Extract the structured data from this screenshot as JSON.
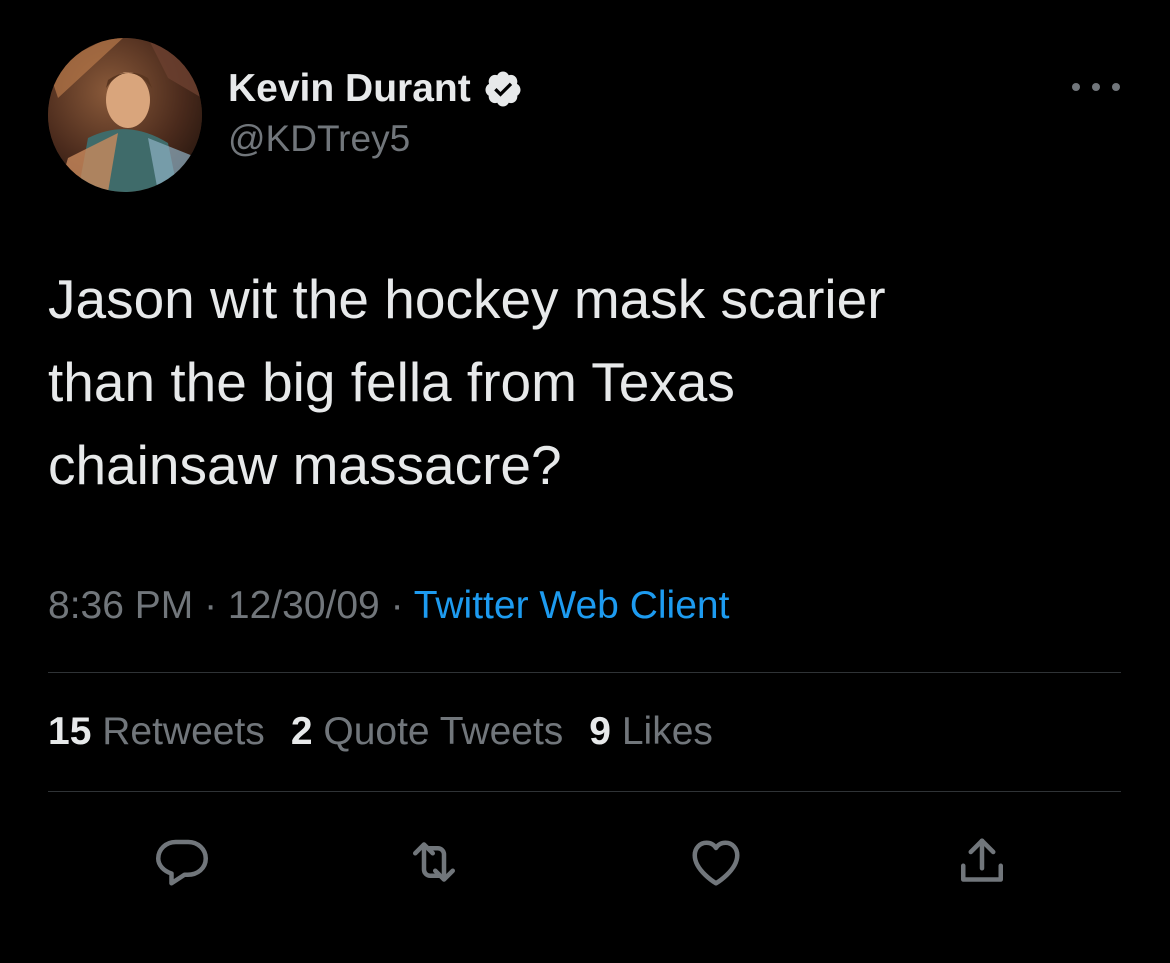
{
  "author": {
    "display_name": "Kevin Durant",
    "handle": "@KDTrey5",
    "verified_icon": "verified-badge-icon",
    "avatar_icon": "avatar"
  },
  "tweet": {
    "text_lines": [
      "Jason wit the hockey mask scarier",
      "than the big fella from Texas",
      "chainsaw massacre?"
    ]
  },
  "meta": {
    "time": "8:36 PM",
    "separator": " · ",
    "date": "12/30/09",
    "source": "Twitter Web Client"
  },
  "stats": {
    "retweets": {
      "count": "15",
      "label": "Retweets"
    },
    "quotes": {
      "count": "2",
      "label": "Quote Tweets"
    },
    "likes": {
      "count": "9",
      "label": "Likes"
    }
  },
  "actions": [
    "reply-icon",
    "retweet-icon",
    "like-icon",
    "share-icon"
  ],
  "colors": {
    "background": "#000000",
    "text": "#e7e9ea",
    "muted": "#71767b",
    "link": "#1d9bf0",
    "divider": "#2f3336"
  }
}
